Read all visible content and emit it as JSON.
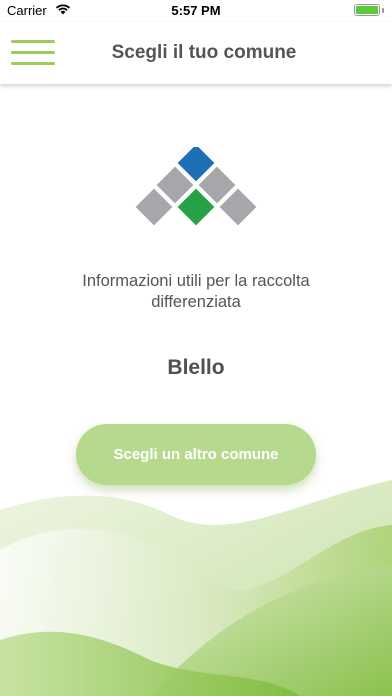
{
  "status_bar": {
    "carrier": "Carrier",
    "time": "5:57 PM",
    "battery_color": "#5ac93b"
  },
  "header": {
    "title": "Scegli il tuo comune",
    "menu_icon": "hamburger-menu-icon",
    "accent_color": "#9ccb5d"
  },
  "logo": {
    "top_tile_color": "#1f6fb6",
    "center_tile_color": "#27a147",
    "side_tile_color": "#a5a7aa"
  },
  "main": {
    "info_text": "Informazioni utili per la raccolta differenziata",
    "town_name": "Blello",
    "change_button_label": "Scegli un altro comune"
  }
}
